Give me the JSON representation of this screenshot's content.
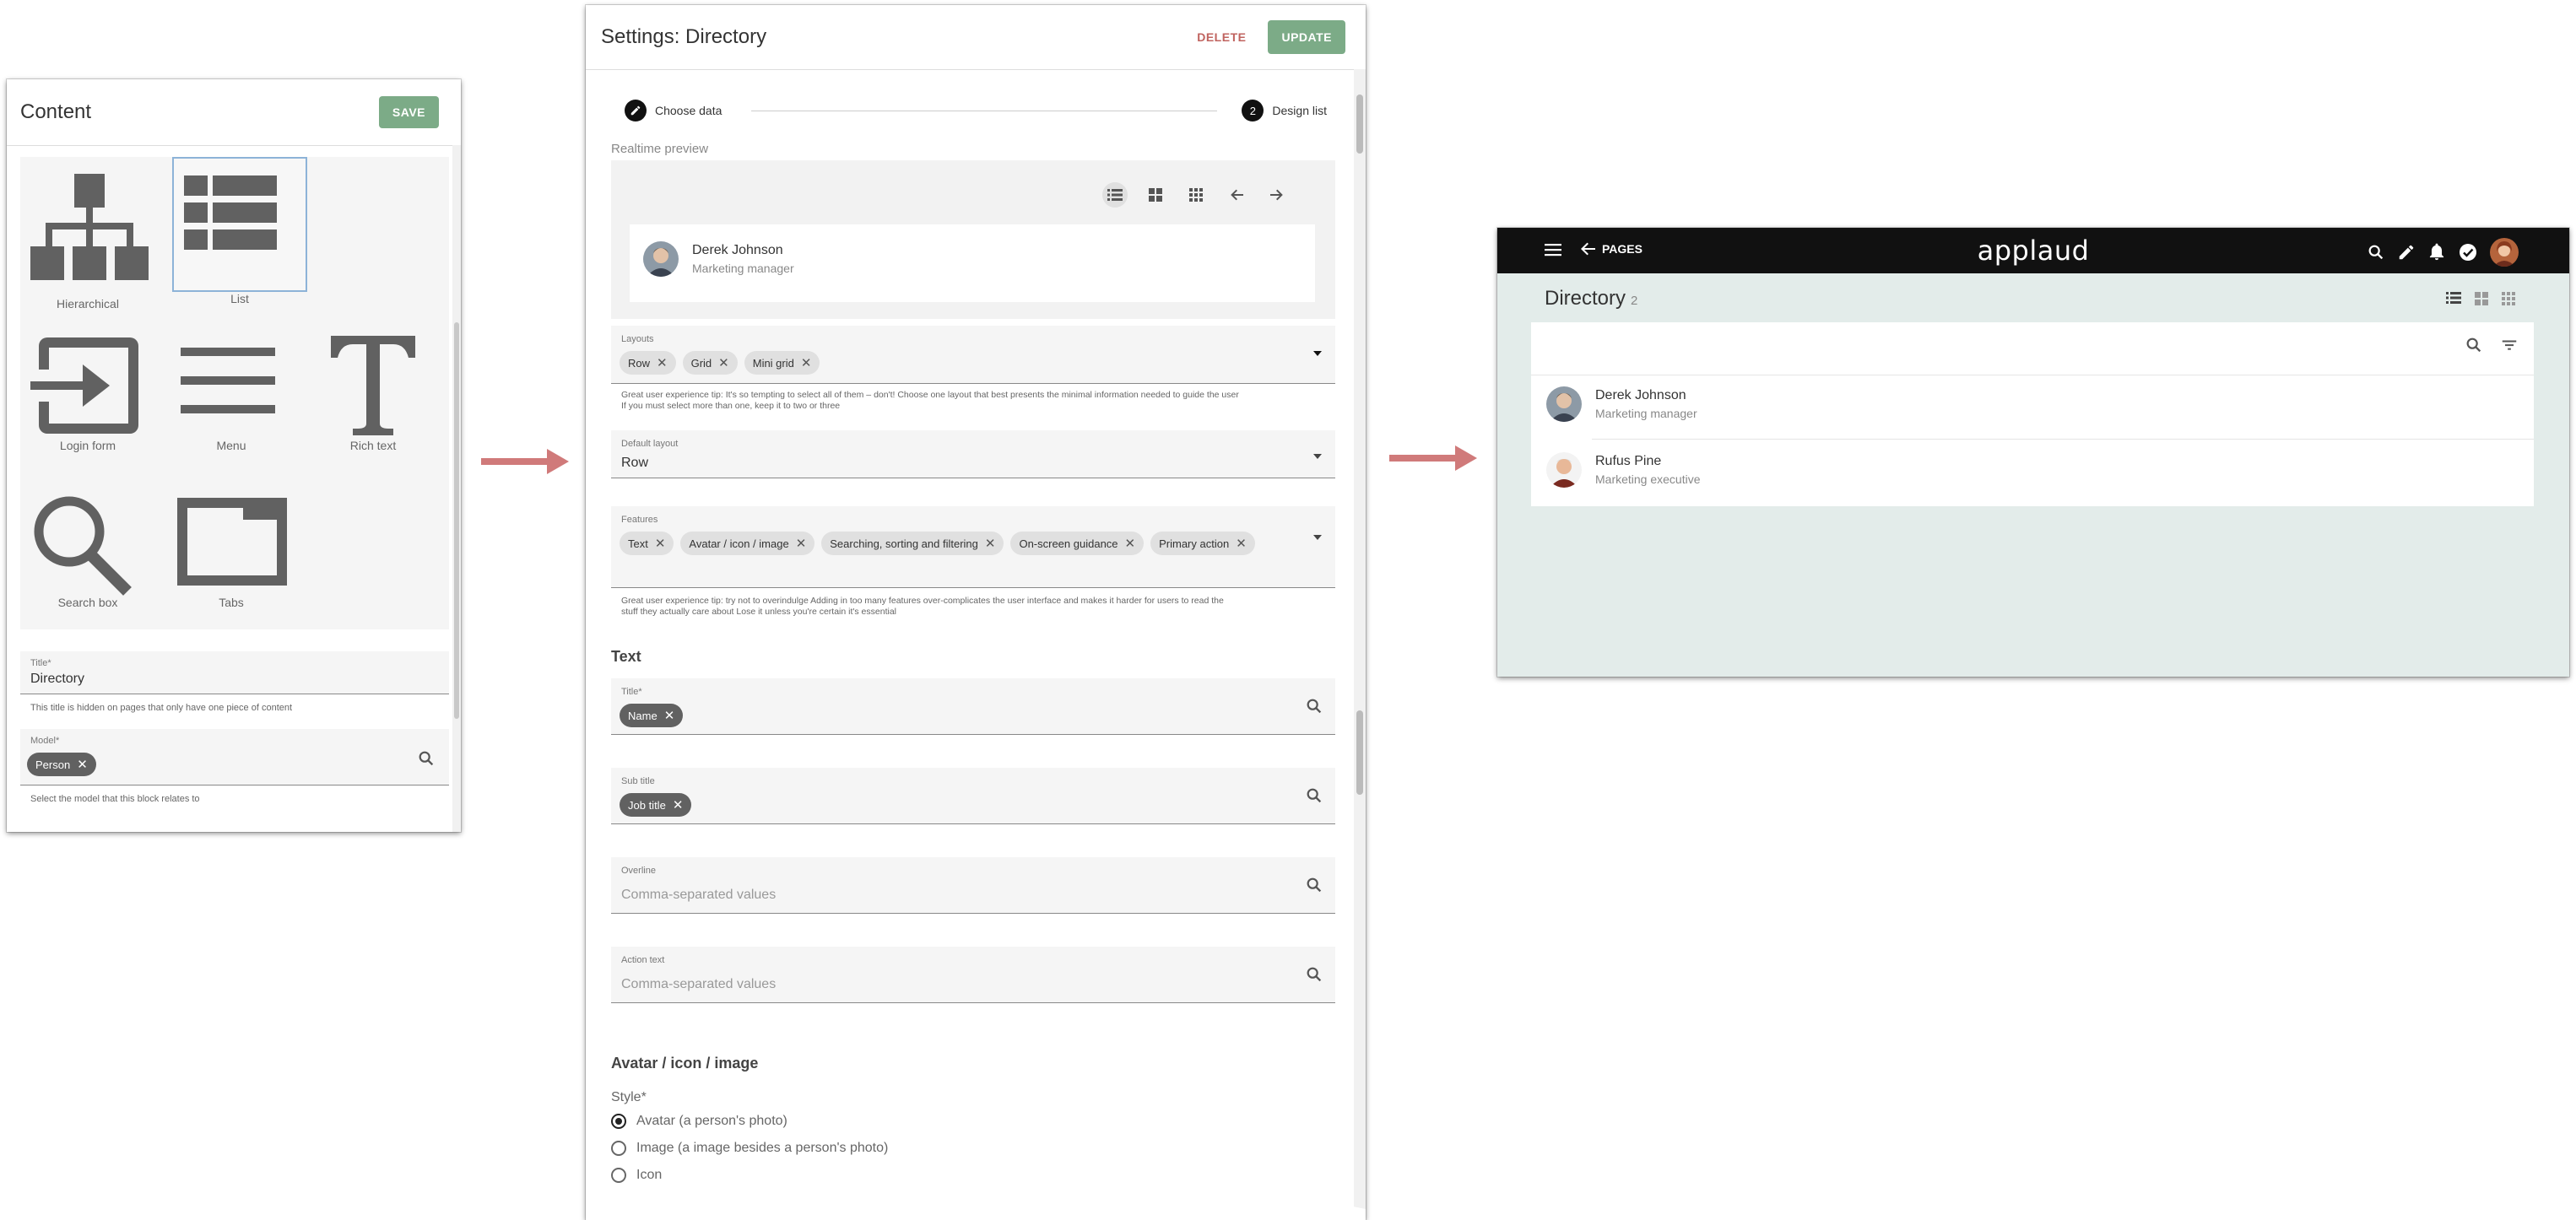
{
  "content_panel": {
    "title": "Content",
    "save_label": "SAVE",
    "tiles": [
      {
        "label": "Hierarchical",
        "icon": "hierarchy-icon"
      },
      {
        "label": "List",
        "icon": "list-icon",
        "selected": true
      },
      {
        "label": "Login form",
        "icon": "login-icon"
      },
      {
        "label": "Menu",
        "icon": "menu-icon"
      },
      {
        "label": "Rich text",
        "icon": "text-icon"
      },
      {
        "label": "Search box",
        "icon": "search-icon"
      },
      {
        "label": "Tabs",
        "icon": "tabs-icon"
      }
    ],
    "title_field": {
      "label": "Title*",
      "value": "Directory",
      "hint": "This title is hidden on pages that only have one piece of content"
    },
    "model_field": {
      "label": "Model*",
      "chip": "Person",
      "hint": "Select the model that this block relates to"
    }
  },
  "settings_panel": {
    "title": "Settings: Directory",
    "delete_label": "DELETE",
    "update_label": "UPDATE",
    "steps": [
      {
        "label": "Choose data",
        "marker": ""
      },
      {
        "label": "Design list",
        "marker": "2"
      }
    ],
    "preview_label": "Realtime preview",
    "preview_person": {
      "name": "Derek Johnson",
      "role": "Marketing manager"
    },
    "layouts": {
      "label": "Layouts",
      "chips": [
        "Row",
        "Grid",
        "Mini grid"
      ],
      "hint_1": "Great user experience tip: It's so tempting to select all of them – don't! Choose one layout that best presents the minimal information needed to guide the user",
      "hint_2": "If you must select more than one, keep it to two or three"
    },
    "default_layout": {
      "label": "Default layout",
      "value": "Row"
    },
    "features": {
      "label": "Features",
      "chips": [
        "Text",
        "Avatar / icon / image",
        "Searching, sorting and filtering",
        "On-screen guidance",
        "Primary action"
      ],
      "hint_1": "Great user experience tip: try not to overindulge Adding in too many features over-complicates the user interface and makes it harder for users to read the",
      "hint_2": "stuff they actually care about Lose it unless you're certain it's essential"
    },
    "text_section": "Text",
    "title_field": {
      "label": "Title*",
      "chip": "Name"
    },
    "subtitle_field": {
      "label": "Sub title",
      "chip": "Job title"
    },
    "overline_field": {
      "label": "Overline",
      "placeholder": "Comma-separated values"
    },
    "action_field": {
      "label": "Action text",
      "placeholder": "Comma-separated values"
    },
    "avatar_section": "Avatar / icon / image",
    "style_label": "Style*",
    "style_options": [
      {
        "label": "Avatar (a person's photo)",
        "selected": true
      },
      {
        "label": "Image (a image besides a person's photo)",
        "selected": false
      },
      {
        "label": "Icon",
        "selected": false
      }
    ]
  },
  "app_preview": {
    "back_label": "PAGES",
    "brand": "applaud",
    "page_title": "Directory",
    "count": "2",
    "people": [
      {
        "name": "Derek Johnson",
        "role": "Marketing manager"
      },
      {
        "name": "Rufus Pine",
        "role": "Marketing executive"
      }
    ]
  },
  "colors": {
    "accent_green": "#7cab87",
    "delete_red": "#c0635f",
    "arrow": "#d07a7a",
    "app_bg": "#e3ecea"
  }
}
